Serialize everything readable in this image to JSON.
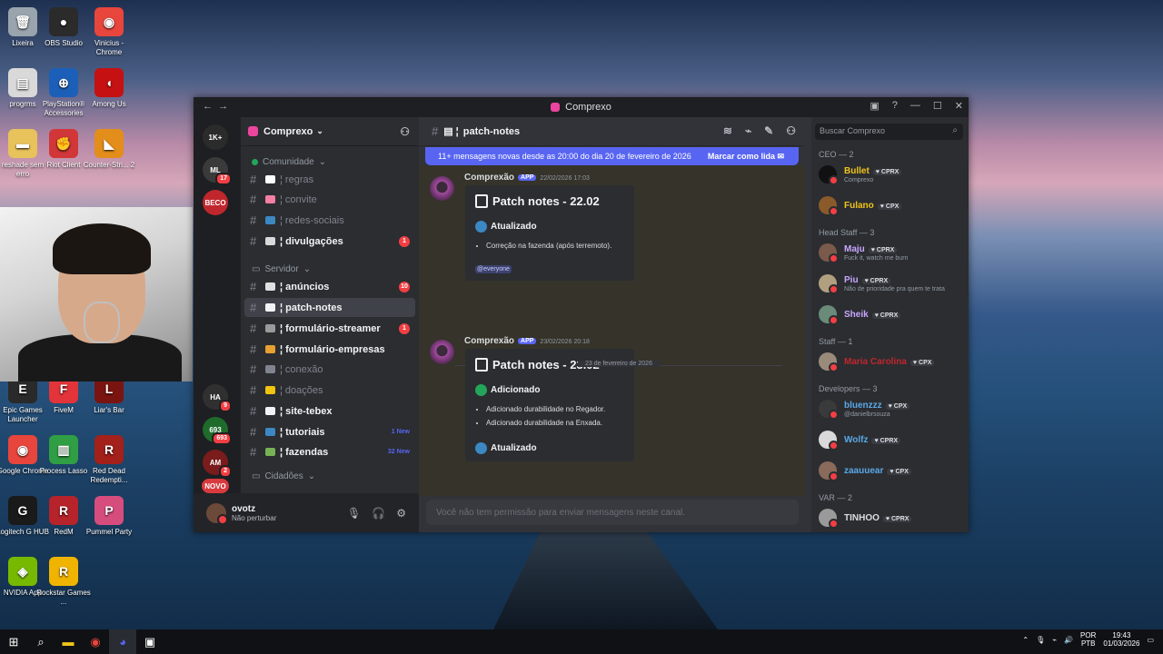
{
  "desktop": {
    "icons": [
      {
        "label": "Lixeira",
        "icon": "recycle-bin-icon",
        "color": "#9aa4ad",
        "glyph": "🗑"
      },
      {
        "label": "OBS Studio",
        "icon": "obs-icon",
        "color": "#2b2b2b",
        "glyph": "●"
      },
      {
        "label": "Vinicius - Chrome",
        "icon": "chrome-icon",
        "color": "#e8453c",
        "glyph": "◉"
      },
      {
        "label": "progrms",
        "icon": "file-icon",
        "color": "#d9d9d9",
        "glyph": "▤"
      },
      {
        "label": "PlayStation® Accessories",
        "icon": "playstation-icon",
        "color": "#1c5fb8",
        "glyph": "⊕"
      },
      {
        "label": "Among Us",
        "icon": "among-us-icon",
        "color": "#c51111",
        "glyph": "◖"
      },
      {
        "label": "reshade sem erro",
        "icon": "folder-icon",
        "color": "#e8c25a",
        "glyph": "▬"
      },
      {
        "label": "Riot Client",
        "icon": "riot-icon",
        "color": "#d13639",
        "glyph": "✊"
      },
      {
        "label": "Counter-Stri... 2",
        "icon": "counter-strike-icon",
        "color": "#e38d1b",
        "glyph": "◣"
      },
      {
        "label": "Epic Games Launcher",
        "icon": "epic-games-icon",
        "color": "#2a2a2a",
        "glyph": "E"
      },
      {
        "label": "FiveM",
        "icon": "fivem-icon",
        "color": "#e3343a",
        "glyph": "F"
      },
      {
        "label": "Liar's Bar",
        "icon": "liars-bar-icon",
        "color": "#7a1410",
        "glyph": "L"
      },
      {
        "label": "Google Chrome",
        "icon": "chrome-icon",
        "color": "#e8453c",
        "glyph": "◉"
      },
      {
        "label": "Process Lasso",
        "icon": "process-lasso-icon",
        "color": "#2f9e44",
        "glyph": "▥"
      },
      {
        "label": "Red Dead Redempti...",
        "icon": "red-dead-icon",
        "color": "#a3201b",
        "glyph": "R"
      },
      {
        "label": "Logitech G HUB",
        "icon": "logitech-icon",
        "color": "#1a1a1a",
        "glyph": "G"
      },
      {
        "label": "RedM",
        "icon": "redm-icon",
        "color": "#b7232a",
        "glyph": "R"
      },
      {
        "label": "Pummel Party",
        "icon": "pummel-party-icon",
        "color": "#d64d7d",
        "glyph": "P"
      },
      {
        "label": "NVIDIA App",
        "icon": "nvidia-icon",
        "color": "#76b900",
        "glyph": "◈"
      },
      {
        "label": "Rockstar Games ...",
        "icon": "rockstar-icon",
        "color": "#f0b400",
        "glyph": "R"
      }
    ]
  },
  "window": {
    "title": "Comprexo",
    "nav_icon": "back-forward-icon",
    "controls": [
      "▣",
      "?",
      "—",
      "☐",
      "✕"
    ]
  },
  "guilds": [
    {
      "label": "1K+",
      "color": "#2b2b2b",
      "badge": ""
    },
    {
      "label": "ML",
      "color": "#3a3a3a",
      "badge": "17"
    },
    {
      "label": "BECO",
      "color": "#c0272d",
      "badge": ""
    },
    {
      "label": "HA",
      "color": "#303030",
      "badge": "9"
    },
    {
      "label": "693",
      "color": "#1e6b2c",
      "badge": "693"
    },
    {
      "label": "AM",
      "color": "#7a1c1c",
      "badge": "2"
    },
    {
      "label": "NOVO",
      "color": "#d83a3e",
      "badge": ""
    }
  ],
  "server": {
    "name": "Comprexo",
    "categories": [
      {
        "label": "Comunidade",
        "has_dot": true
      },
      {
        "label": "Servidor",
        "has_dot": false
      },
      {
        "label": "Cidadões",
        "has_dot": false
      }
    ],
    "channels": [
      {
        "name": "regras",
        "emoji_color": "#ffffff",
        "state": "read",
        "badge": "",
        "new": ""
      },
      {
        "name": "convite",
        "emoji_color": "#f47fa4",
        "state": "read",
        "badge": "",
        "new": ""
      },
      {
        "name": "redes-sociais",
        "emoji_color": "#3b88c3",
        "state": "read",
        "badge": "",
        "new": ""
      },
      {
        "name": "divulgações",
        "emoji_color": "#d9d9d9",
        "state": "unread",
        "badge": "1",
        "new": ""
      },
      {
        "name": "anúncios",
        "emoji_color": "#e0e0e0",
        "state": "unread",
        "badge": "10",
        "new": ""
      },
      {
        "name": "patch-notes",
        "emoji_color": "#f2f3f5",
        "state": "selected",
        "badge": "",
        "new": ""
      },
      {
        "name": "formulário-streamer",
        "emoji_color": "#9a9a9a",
        "state": "unread",
        "badge": "1",
        "new": ""
      },
      {
        "name": "formulário-empresas",
        "emoji_color": "#e8a030",
        "state": "unread",
        "badge": "",
        "new": ""
      },
      {
        "name": "conexão",
        "emoji_color": "#80848e",
        "state": "read",
        "badge": "",
        "new": ""
      },
      {
        "name": "doações",
        "emoji_color": "#f1c40f",
        "state": "read",
        "badge": "",
        "new": ""
      },
      {
        "name": "site-tebex",
        "emoji_color": "#f2f3f5",
        "state": "unread",
        "badge": "",
        "new": ""
      },
      {
        "name": "tutoriais",
        "emoji_color": "#3b88c3",
        "state": "unread",
        "badge": "",
        "new": "1 New"
      },
      {
        "name": "fazendas",
        "emoji_color": "#77b255",
        "state": "unread",
        "badge": "",
        "new": "32 New"
      }
    ]
  },
  "user": {
    "name": "ovotz",
    "status": "Não perturbar"
  },
  "chat": {
    "channel": "patch-notes",
    "banner": "11+ mensagens novas desde as 20:00 do dia 20 de fevereiro de 2026",
    "mark_read": "Marcar como lida",
    "date_divider": "23 de fevereiro de 2026",
    "composer": "Você não tem permissão para enviar mensagens neste canal.",
    "messages": [
      {
        "author": "Comprexão",
        "app_tag": "APP",
        "timestamp": "22/02/2026 17:03",
        "embed_title": "Patch notes - 22.02",
        "sections": [
          {
            "title": "Atualizado",
            "color": "#3b88c3",
            "items": [
              "Correção na fazenda (após terremoto)."
            ]
          }
        ],
        "mention": "@everyone"
      },
      {
        "author": "Comprexão",
        "app_tag": "APP",
        "timestamp": "23/02/2026 20:18",
        "embed_title": "Patch notes - 23.02",
        "sections": [
          {
            "title": "Adicionado",
            "color": "#23a55a",
            "items": [
              "Adicionado durabilidade no Regador.",
              "Adicionado durabilidade na Enxada."
            ]
          },
          {
            "title": "Atualizado",
            "color": "#3b88c3",
            "items": []
          }
        ],
        "mention": ""
      }
    ]
  },
  "members": {
    "search_placeholder": "Buscar Comprexo",
    "groups": [
      {
        "label": "CEO — 2",
        "members": [
          {
            "name": "Bullet",
            "color": "#f0c419",
            "tag": "CPRX",
            "sub": "Comprexo",
            "avatar": "#111111"
          },
          {
            "name": "Fulano",
            "color": "#f0c419",
            "tag": "CPX",
            "sub": "",
            "avatar": "#8a5a2b"
          }
        ]
      },
      {
        "label": "Head Staff — 3",
        "members": [
          {
            "name": "Maju",
            "color": "#c9a7ff",
            "tag": "CPRX",
            "sub": "Fuck it, watch me burn",
            "avatar": "#7a5a4a"
          },
          {
            "name": "Piu",
            "color": "#c9a7ff",
            "tag": "CPRX",
            "sub": "Não de prioridade pra quem te trata",
            "avatar": "#b0a080"
          },
          {
            "name": "Sheik",
            "color": "#c9a7ff",
            "tag": "CPRX",
            "sub": "",
            "avatar": "#6a8a7a"
          }
        ]
      },
      {
        "label": "Staff — 1",
        "members": [
          {
            "name": "Maria Carolina",
            "color": "#c0272d",
            "tag": "CPX",
            "sub": "",
            "avatar": "#9a8a7a"
          }
        ]
      },
      {
        "label": "Developers — 3",
        "members": [
          {
            "name": "bluenzzz",
            "color": "#5aa9e6",
            "tag": "CPX",
            "sub": "@danielbrsouza",
            "avatar": "#3a3a3a"
          },
          {
            "name": "Wolfz",
            "color": "#5aa9e6",
            "tag": "CPRX",
            "sub": "",
            "avatar": "#d9d9d9"
          },
          {
            "name": "zaauuear",
            "color": "#5aa9e6",
            "tag": "CPX",
            "sub": "",
            "avatar": "#8a6a5a"
          }
        ]
      },
      {
        "label": "VAR — 2",
        "members": [
          {
            "name": "TINHOO",
            "color": "#dbdee1",
            "tag": "CPRX",
            "sub": "",
            "avatar": "#9a9a9a"
          }
        ]
      }
    ]
  },
  "taskbar": {
    "apps": [
      "windows-start-icon",
      "search-icon",
      "file-explorer-icon",
      "chrome-icon",
      "discord-icon",
      "terminal-icon"
    ],
    "language": "POR",
    "layout": "PTB",
    "time": "19:43",
    "date": "01/03/2026"
  }
}
